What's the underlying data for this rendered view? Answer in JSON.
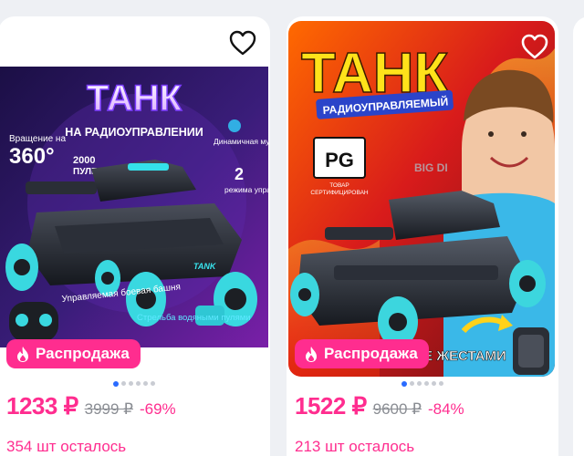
{
  "products": [
    {
      "badge": "Распродажа",
      "price": "1233 ₽",
      "old_price": "3999 ₽",
      "discount": "-69%",
      "stock": "354 шт осталось",
      "image": {
        "title": "ТАНК",
        "subtitle": "НА РАДИОУПРАВЛЕНИИ",
        "rotation_label": "Вращение на",
        "rotation_value": "360°",
        "bullets_value": "2000",
        "bullets_label": "ПУЛЕК",
        "music_label": "Динамичная музыка",
        "modes_value": "2",
        "modes_label": "режима управления",
        "turret_label": "Управляемая боевая башня",
        "shoot_label": "Стрельба водяными пулями",
        "tank_label": "TANK"
      }
    },
    {
      "badge": "Распродажа",
      "price": "1522 ₽",
      "old_price": "9600 ₽",
      "discount": "-84%",
      "stock": "213 шт осталось",
      "image": {
        "title": "ТАНК",
        "subtitle": "РАДИОУПРАВЛЯЕМЫЙ",
        "cert_line1": "ТОВАР",
        "cert_line2": "СЕРТИФИЦИРОВАН",
        "brand": "BIG DI",
        "gesture": "УПРАВЛЕНИЕ ЖЕСТАМИ"
      }
    }
  ]
}
